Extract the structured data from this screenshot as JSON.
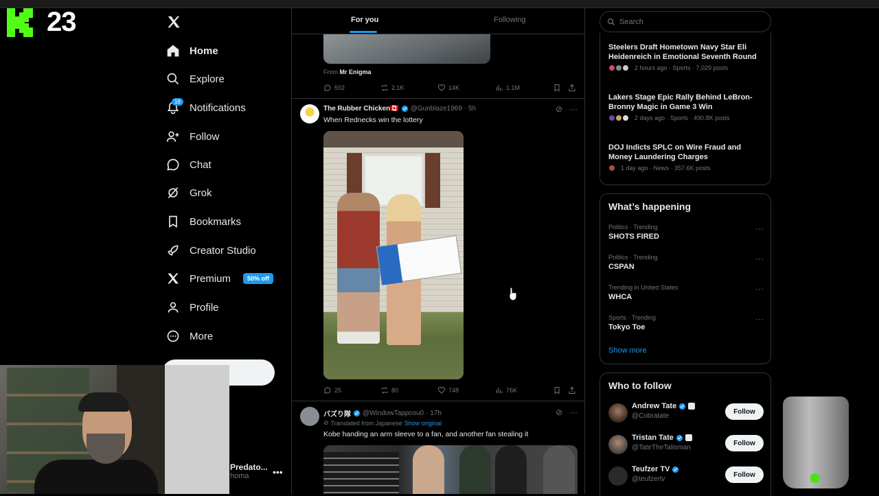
{
  "overlay": {
    "kick_count": "23"
  },
  "nav": {
    "items": [
      {
        "label": "Home"
      },
      {
        "label": "Explore"
      },
      {
        "label": "Notifications",
        "badge": "18"
      },
      {
        "label": "Follow"
      },
      {
        "label": "Chat"
      },
      {
        "label": "Grok"
      },
      {
        "label": "Bookmarks"
      },
      {
        "label": "Creator Studio"
      },
      {
        "label": "Premium",
        "pill": "50% off"
      },
      {
        "label": "Profile"
      },
      {
        "label": "More"
      }
    ]
  },
  "account": {
    "name": "Predato...",
    "handle": "homa"
  },
  "feed": {
    "tabs": [
      "For you",
      "Following"
    ],
    "prev_post": {
      "from_prefix": "From",
      "from_name": "Mr Enigma",
      "replies": "502",
      "reposts": "2.1K",
      "likes": "14K",
      "views": "1.1M"
    },
    "post1": {
      "name": "The Rubber Chicken🇨🇦",
      "handle": "@Gunblaze1969",
      "time": "· 5h",
      "text": "When Rednecks win the lottery",
      "replies": "25",
      "reposts": "80",
      "likes": "748",
      "views": "76K"
    },
    "post2": {
      "name": "バズり隊",
      "handle": "@WindowTappcou0",
      "time": "· 17h",
      "translated": "Translated from Japanese",
      "show_original": "Show original",
      "text": "Kobe handing an arm sleeve to a fan, and another fan stealing it"
    }
  },
  "search": {
    "placeholder": "Search"
  },
  "news": [
    {
      "title": "Steelers Draft Hometown Navy Star Eli Heidenreich in Emotional Seventh Round",
      "meta": "2 hours ago · Sports · 7,029 posts"
    },
    {
      "title": "Lakers Stage Epic Rally Behind LeBron-Bronny Magic in Game 3 Win",
      "meta": "2 days ago · Sports · 490.8K posts"
    },
    {
      "title": "DOJ Indicts SPLC on Wire Fraud and Money Laundering Charges",
      "meta": "1 day ago · News · 357.6K posts"
    }
  ],
  "happening": {
    "title": "What’s happening",
    "trends": [
      {
        "context": "Politics · Trending",
        "name": "SHOTS FIRED"
      },
      {
        "context": "Politics · Trending",
        "name": "CSPAN"
      },
      {
        "context": "Trending in United States",
        "name": "WHCA"
      },
      {
        "context": "Sports · Trending",
        "name": "Tokyo Toe"
      }
    ],
    "show_more": "Show more"
  },
  "who_to_follow": {
    "title": "Who to follow",
    "follow_label": "Follow",
    "accounts": [
      {
        "name": "Andrew Tate",
        "handle": "@Cobratate"
      },
      {
        "name": "Tristan Tate",
        "handle": "@TateTheTalisman"
      },
      {
        "name": "Teufzer TV",
        "handle": "@teufzertv"
      }
    ]
  },
  "colors": {
    "accent": "#1d9bf0",
    "kick": "#53fc18",
    "bg": "#000000",
    "muted": "#71767b"
  }
}
